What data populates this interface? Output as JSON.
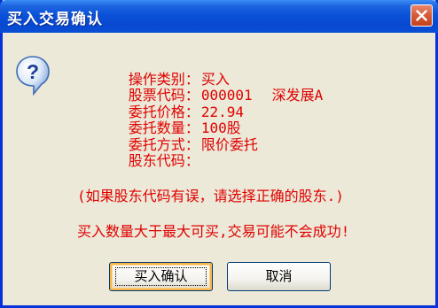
{
  "window": {
    "title": "买入交易确认",
    "close_icon": "close-x-icon"
  },
  "icon": "question-icon",
  "order": {
    "rows": [
      {
        "label": "操作类别",
        "value": "买入",
        "extra": ""
      },
      {
        "label": "股票代码",
        "value": "000001",
        "extra": "深发展A"
      },
      {
        "label": "委托价格",
        "value": "22.94",
        "extra": ""
      },
      {
        "label": "委托数量",
        "value": "100股",
        "extra": ""
      },
      {
        "label": "委托方式",
        "value": "限价委托",
        "extra": ""
      },
      {
        "label": "股东代码",
        "value": "",
        "extra": ""
      }
    ],
    "separator": "："
  },
  "note": "(如果股东代码有误，请选择正确的股东.)",
  "warning": "买入数量大于最大可买,交易可能不会成功!",
  "buttons": {
    "confirm_label": "买入确认",
    "cancel_label": "取消"
  },
  "colors": {
    "text_red": "#e00000",
    "title_blue": "#0a52d8",
    "close_red": "#d65a36"
  }
}
